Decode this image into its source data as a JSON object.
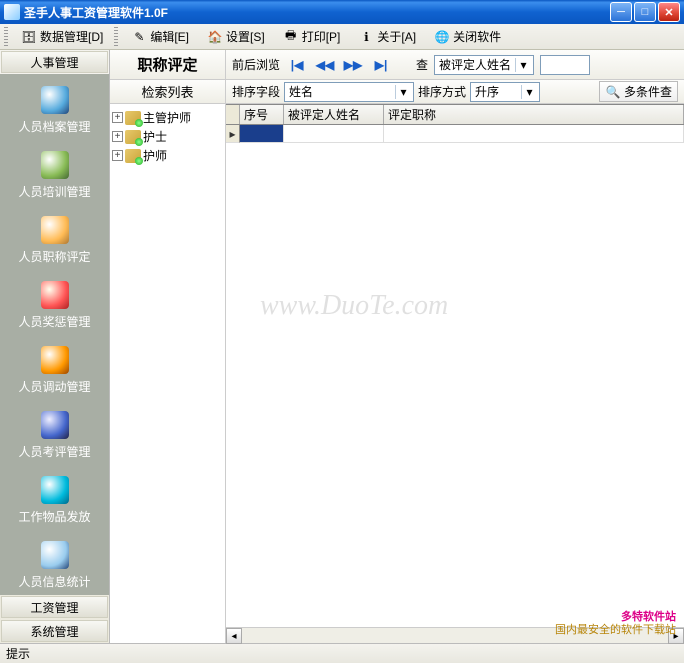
{
  "window": {
    "title": "圣手人事工资管理软件1.0F"
  },
  "menu": {
    "items": [
      {
        "label": "数据管理[D]"
      },
      {
        "label": "编辑[E]"
      },
      {
        "label": "设置[S]"
      },
      {
        "label": "打印[P]"
      },
      {
        "label": "关于[A]"
      },
      {
        "label": "关闭软件"
      }
    ]
  },
  "sidebar": {
    "header": "人事管理",
    "items": [
      {
        "label": "人员档案管理"
      },
      {
        "label": "人员培训管理"
      },
      {
        "label": "人员职称评定"
      },
      {
        "label": "人员奖惩管理"
      },
      {
        "label": "人员调动管理"
      },
      {
        "label": "人员考评管理"
      },
      {
        "label": "工作物品发放"
      },
      {
        "label": "人员信息统计"
      }
    ],
    "footer": [
      {
        "label": "工资管理"
      },
      {
        "label": "系统管理"
      }
    ]
  },
  "page": {
    "title": "职称评定",
    "browse_label": "前后浏览",
    "search_label": "查",
    "search_field": "被评定人姓名",
    "search_value": ""
  },
  "tree": {
    "header": "检索列表",
    "nodes": [
      {
        "label": "主管护师"
      },
      {
        "label": "护士"
      },
      {
        "label": "护师"
      }
    ]
  },
  "filter": {
    "sort_field_label": "排序字段",
    "sort_field_value": "姓名",
    "sort_order_label": "排序方式",
    "sort_order_value": "升序",
    "multi_label": "多条件查"
  },
  "grid": {
    "columns": [
      {
        "label": "序号"
      },
      {
        "label": "被评定人姓名"
      },
      {
        "label": "评定职称"
      }
    ]
  },
  "status": {
    "hint": "提示"
  },
  "watermark": "www.DuoTe.com",
  "corner": {
    "line1": "多特软件站",
    "line2": "国内最安全的软件下载站"
  }
}
